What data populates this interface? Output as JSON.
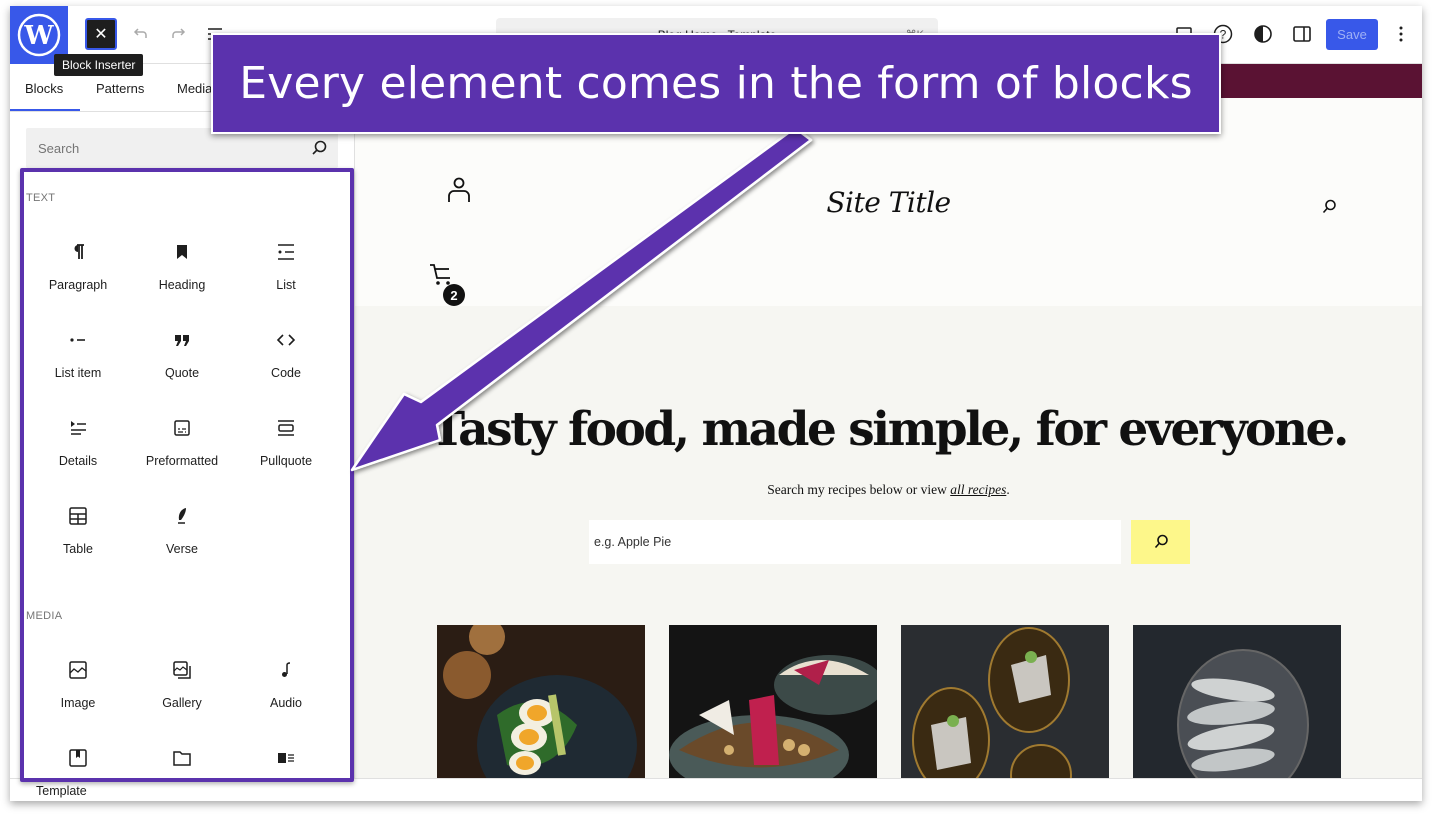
{
  "topbar": {
    "logo": "wordpress-logo",
    "inserter_tooltip": "Block Inserter",
    "document_title": "Blog Home · Template",
    "shortcut": "⌘K",
    "save_label": "Save",
    "accent": "#3858e9"
  },
  "sidebar": {
    "tabs": [
      {
        "label": "Blocks"
      },
      {
        "label": "Patterns"
      },
      {
        "label": "Media"
      }
    ],
    "search_placeholder": "Search",
    "categories": [
      {
        "label": "TEXT",
        "blocks": [
          {
            "label": "Paragraph",
            "icon": "paragraph-icon"
          },
          {
            "label": "Heading",
            "icon": "heading-icon"
          },
          {
            "label": "List",
            "icon": "list-icon"
          },
          {
            "label": "List item",
            "icon": "list-item-icon"
          },
          {
            "label": "Quote",
            "icon": "quote-icon"
          },
          {
            "label": "Code",
            "icon": "code-icon"
          },
          {
            "label": "Details",
            "icon": "details-icon"
          },
          {
            "label": "Preformatted",
            "icon": "preformatted-icon"
          },
          {
            "label": "Pullquote",
            "icon": "pullquote-icon"
          },
          {
            "label": "Table",
            "icon": "table-icon"
          },
          {
            "label": "Verse",
            "icon": "verse-icon"
          }
        ]
      },
      {
        "label": "MEDIA",
        "blocks": [
          {
            "label": "Image",
            "icon": "image-icon"
          },
          {
            "label": "Gallery",
            "icon": "gallery-icon"
          },
          {
            "label": "Audio",
            "icon": "audio-icon"
          },
          {
            "label": "",
            "icon": "cover-icon"
          },
          {
            "label": "",
            "icon": "file-icon"
          },
          {
            "label": "",
            "icon": "media-text-icon"
          }
        ]
      }
    ]
  },
  "canvas": {
    "site_title": "Site Title",
    "cart_count": "2",
    "hero_title": "Tasty food, made simple, for everyone.",
    "hero_sub_before": "Search my recipes below or view ",
    "hero_sub_link": "all recipes",
    "hero_sub_after": ".",
    "recipe_search_placeholder": "e.g. Apple Pie",
    "photos": [
      {
        "alt": "Egg and avocado toast"
      },
      {
        "alt": "Grain bowl with pomegranate"
      },
      {
        "alt": "Cake slices on dark plates"
      },
      {
        "alt": "Sardines on a plate"
      }
    ],
    "colors": {
      "header_band": "#5a1233",
      "search_button": "#fdf78a"
    }
  },
  "bottombar": {
    "breadcrumb": "Template"
  },
  "annotation": {
    "banner_text": "Every element comes in the form of blocks",
    "color": "#5b32ad"
  }
}
